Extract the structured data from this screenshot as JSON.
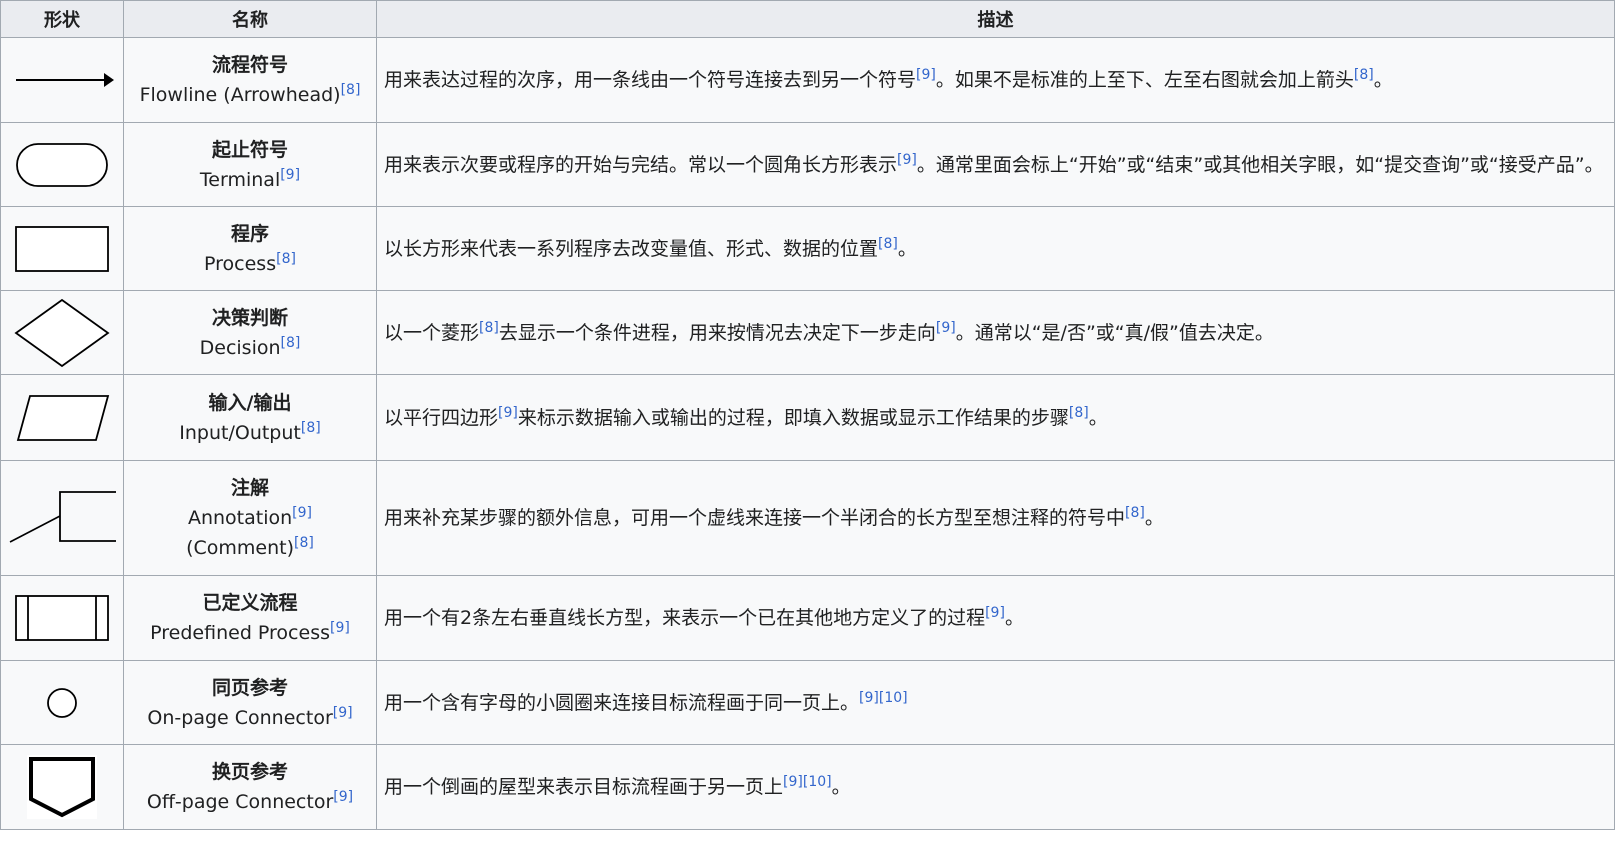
{
  "header": {
    "shape": "形状",
    "name": "名称",
    "description": "描述"
  },
  "rows": [
    {
      "zh": "流程符号",
      "en": "Flowline (Arrowhead)",
      "en_ref": "[8]",
      "desc": [
        {
          "t": "用来表达过程的次序，用一条线由一个符号连接去到另一个符号"
        },
        {
          "r": "[9]"
        },
        {
          "t": "。如果不是标准的上至下、左至右图就会加上箭头"
        },
        {
          "r": "[8]"
        },
        {
          "t": "。"
        }
      ]
    },
    {
      "zh": "起止符号",
      "en": "Terminal",
      "en_ref": "[9]",
      "desc": [
        {
          "t": "用来表示次要或程序的开始与完结。常以一个圆角长方形表示"
        },
        {
          "r": "[9]"
        },
        {
          "t": "。通常里面会标上“开始”或“结束”或其他相关字眼，如“提交查询”或“接受产品”。"
        }
      ]
    },
    {
      "zh": "程序",
      "en": "Process",
      "en_ref": "[8]",
      "desc": [
        {
          "t": "以长方形来代表一系列程序去改变量值、形式、数据的位置"
        },
        {
          "r": "[8]"
        },
        {
          "t": "。"
        }
      ]
    },
    {
      "zh": "决策判断",
      "en": "Decision",
      "en_ref": "[8]",
      "desc": [
        {
          "t": "以一个菱形"
        },
        {
          "r": "[8]"
        },
        {
          "t": "去显示一个条件进程，用来按情况去决定下一步走向"
        },
        {
          "r": "[9]"
        },
        {
          "t": "。通常以“是/否”或“真/假”值去决定。"
        }
      ]
    },
    {
      "zh": "输入/输出",
      "en": "Input/Output",
      "en_ref": "[8]",
      "desc": [
        {
          "t": "以平行四边形"
        },
        {
          "r": "[9]"
        },
        {
          "t": "来标示数据输入或输出的过程，即填入数据或显示工作结果的步骤"
        },
        {
          "r": "[8]"
        },
        {
          "t": "。"
        }
      ]
    },
    {
      "zh": "注解",
      "en": "Annotation",
      "en_ref": "[9]",
      "en2": "(Comment)",
      "en2_ref": "[8]",
      "desc": [
        {
          "t": "用来补充某步骤的额外信息，可用一个虚线来连接一个半闭合的长方型至想注释的符号中"
        },
        {
          "r": "[8]"
        },
        {
          "t": "。"
        }
      ]
    },
    {
      "zh": "已定义流程",
      "en": "Predefined Process",
      "en_ref": "[9]",
      "desc": [
        {
          "t": "用一个有2条左右垂直线长方型，来表示一个已在其他地方定义了的过程"
        },
        {
          "r": "[9]"
        },
        {
          "t": "。"
        }
      ]
    },
    {
      "zh": "同页参考",
      "en": "On-page Connector",
      "en_ref": "[9]",
      "desc": [
        {
          "t": "用一个含有字母的小圆圈来连接目标流程画于同一页上。"
        },
        {
          "r": "[9]"
        },
        {
          "r": "[10]"
        }
      ]
    },
    {
      "zh": "换页参考",
      "en": "Off-page Connector",
      "en_ref": "[9]",
      "desc": [
        {
          "t": "用一个倒画的屋型来表示目标流程画于另一页上"
        },
        {
          "r": "[9]"
        },
        {
          "r": "[10]"
        },
        {
          "t": "。"
        }
      ]
    }
  ]
}
